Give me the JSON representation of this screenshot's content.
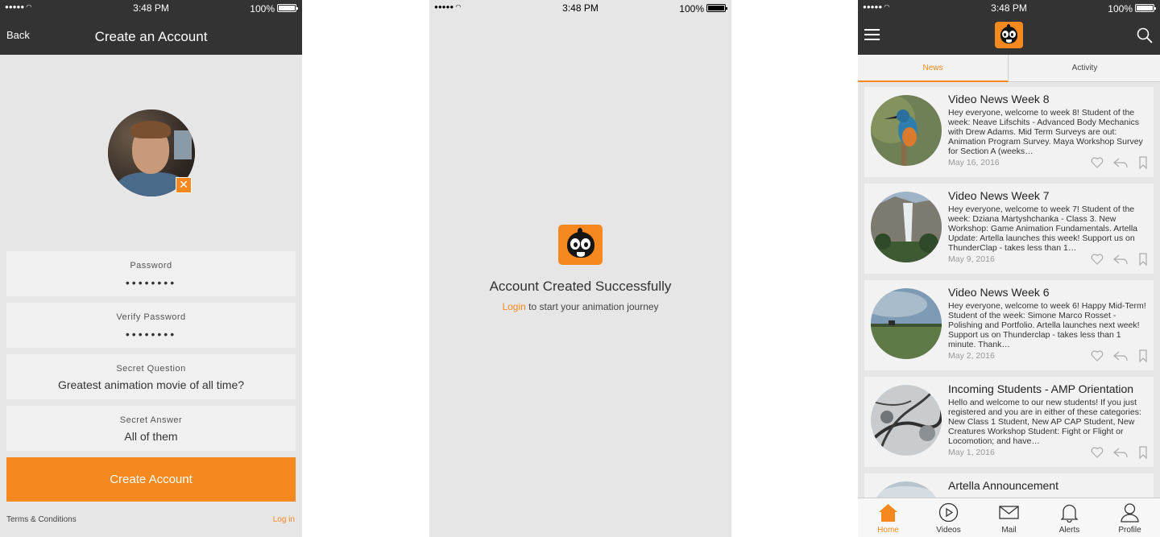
{
  "status": {
    "time": "3:48 PM",
    "battery": "100%"
  },
  "signup": {
    "back": "Back",
    "title": "Create an Account",
    "fields": [
      {
        "label": "Password",
        "value": "••••••••"
      },
      {
        "label": "Verify Password",
        "value": "••••••••"
      },
      {
        "label": "Secret Question",
        "value": "Greatest animation movie of all time?"
      },
      {
        "label": "Secret Answer",
        "value": "All of them"
      }
    ],
    "create_button": "Create Account",
    "terms": "Terms & Conditions",
    "login": "Log in"
  },
  "success": {
    "title": "Account Created Successfully",
    "login_link": "Login",
    "subtitle_rest": " to start your animation journey"
  },
  "feed": {
    "tabs": [
      {
        "label": "News",
        "active": true
      },
      {
        "label": "Activity",
        "active": false
      }
    ],
    "cards": [
      {
        "title": "Video News Week 8",
        "body": "Hey everyone, welcome to week 8! Student of the week: Neave Lifschits - Advanced Body Mechanics with Drew Adams. Mid Term Surveys are out: Animation Program Survey. Maya Workshop Survey for Section A (weeks…",
        "date": "May 16, 2016",
        "image": "kingfisher"
      },
      {
        "title": "Video News Week 7",
        "body": "Hey everyone, welcome to week 7! Student of the week: Dziana Martyshchanka - Class 3. New Workshop: Game Animation Fundamentals. Artella Update: Artella launches this week! Support us on ThunderClap - takes less than 1…",
        "date": "May 9, 2016",
        "image": "waterfall"
      },
      {
        "title": "Video News Week 6",
        "body": "Hey everyone, welcome to week 6! Happy Mid-Term! Student of the week: Simone Marco Rosset - Polishing and Portfolio. Artella launches next week! Support us on Thunderclap - takes less than 1 minute. Thank…",
        "date": "May 2, 2016",
        "image": "meadow"
      },
      {
        "title": "Incoming Students - AMP Orientation",
        "body": "Hello and welcome to our new students! If you just registered and you are in either of these categories: New Class 1 Student, New AP CAP Student, New Creatures Workshop Student: Fight or Flight or Locomotion; and have…",
        "date": "May 1, 2016",
        "image": "trees"
      },
      {
        "title": "Artella Announcement",
        "body": "",
        "date": "",
        "image": "sky"
      }
    ],
    "tabbar": [
      {
        "label": "Home",
        "icon": "home-icon",
        "active": true
      },
      {
        "label": "Videos",
        "icon": "play-icon",
        "active": false
      },
      {
        "label": "Mail",
        "icon": "mail-icon",
        "active": false
      },
      {
        "label": "Alerts",
        "icon": "bell-icon",
        "active": false
      },
      {
        "label": "Profile",
        "icon": "person-icon",
        "active": false
      }
    ]
  },
  "colors": {
    "accent": "#f5891f",
    "navbar": "#333333",
    "background": "#e6e6e6"
  }
}
